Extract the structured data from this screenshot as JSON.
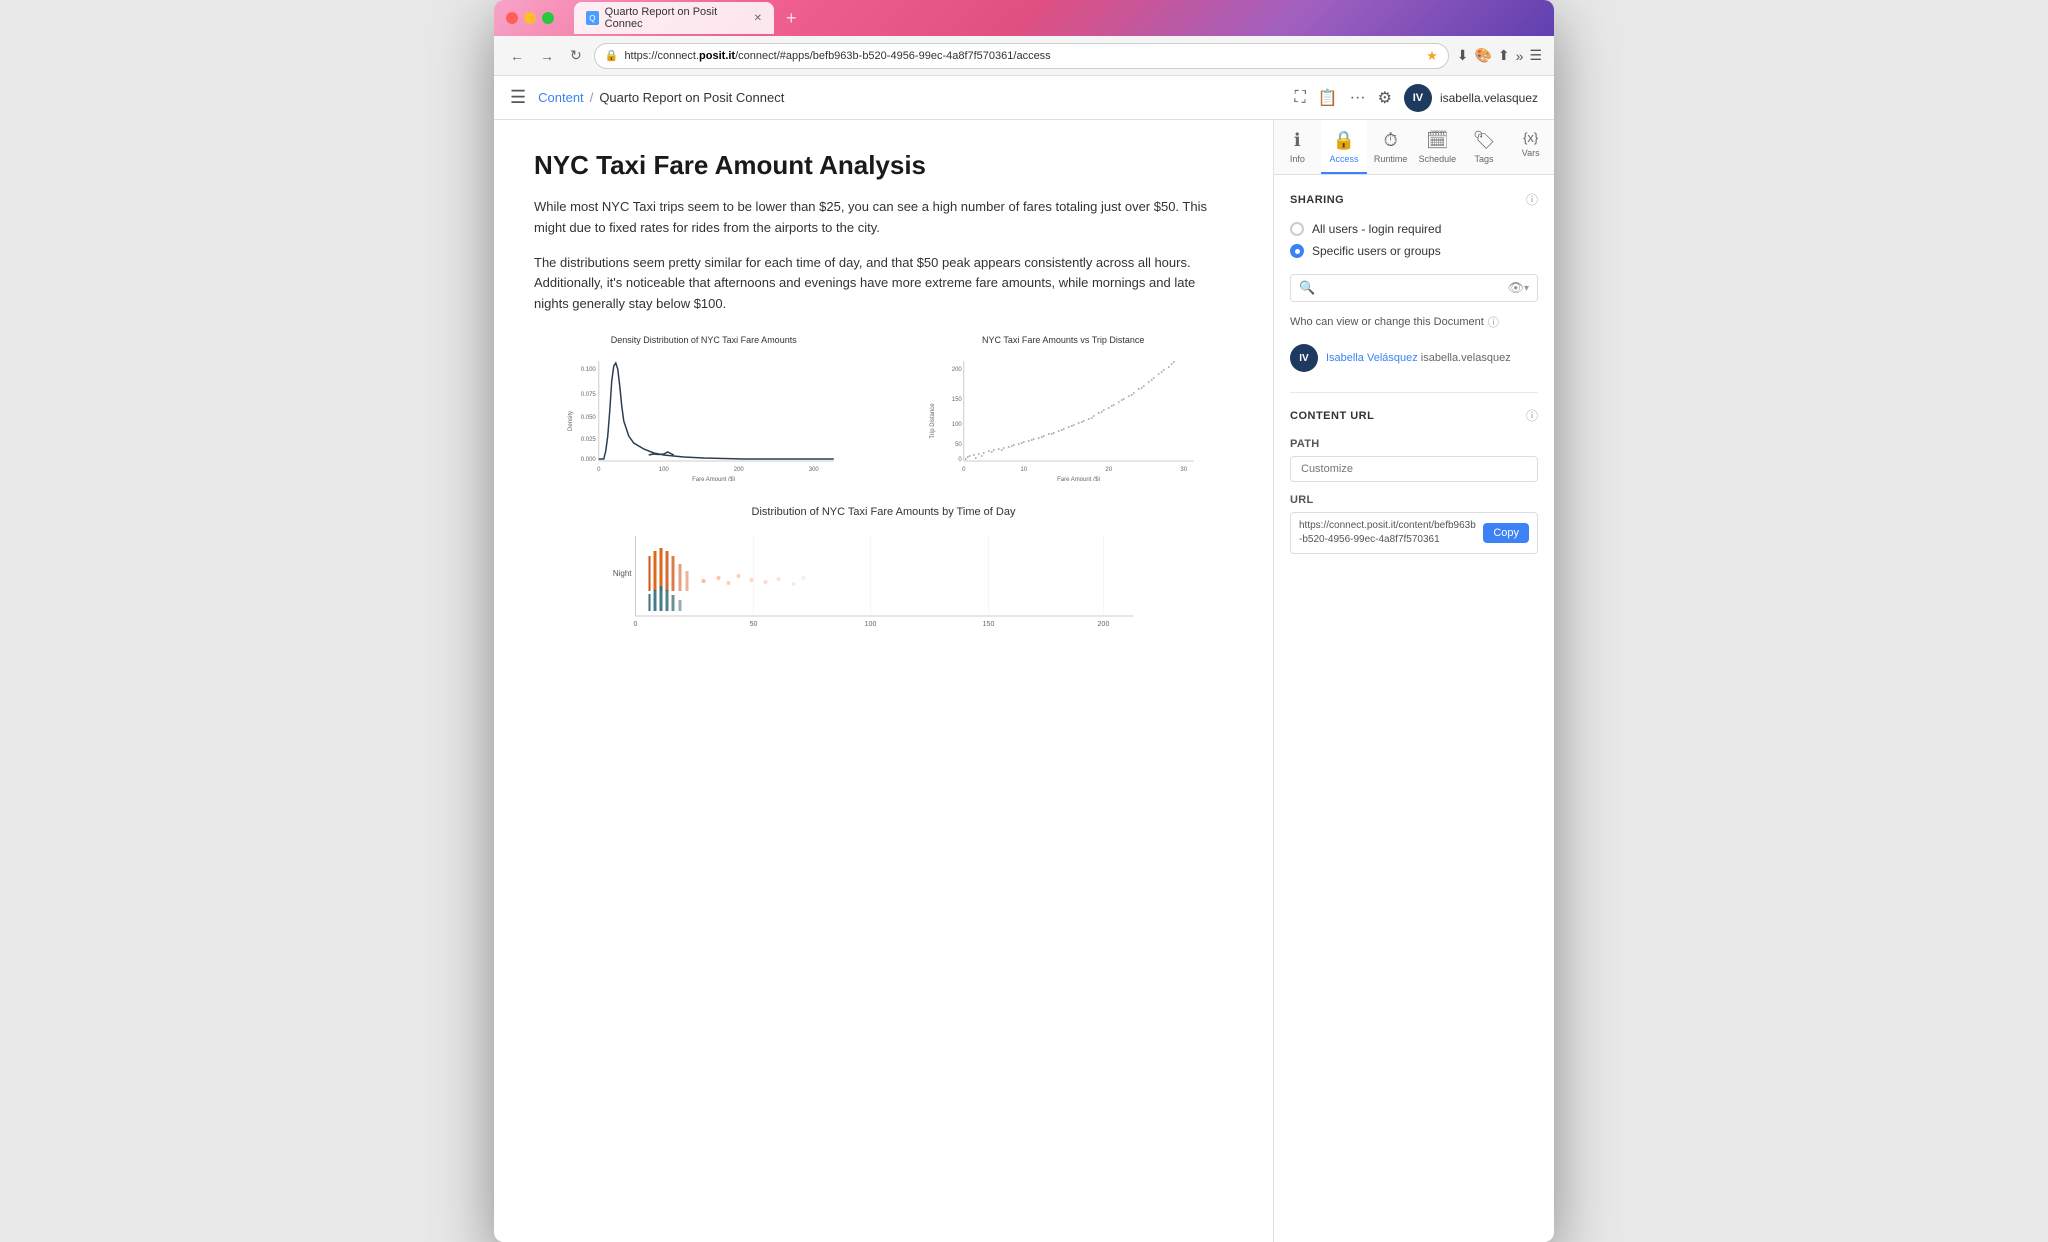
{
  "browser": {
    "tab_label": "Quarto Report on Posit Connec",
    "url": "https://connect.posit.it/connect/#apps/befb963b-b520-4956-99ec-4a8f7f570361/access",
    "url_domain": "connect.posit.it",
    "url_path": "/connect/#apps/befb963b-b520-4956-99ec-4a8f7f570361/access"
  },
  "header": {
    "menu_icon": "☰",
    "breadcrumb_link": "Content",
    "breadcrumb_separator": "/",
    "breadcrumb_current": "Quarto Report on Posit Connect",
    "user_name": "isabella.velasquez",
    "user_initials": "IV"
  },
  "report": {
    "title": "NYC Taxi Fare Amount Analysis",
    "paragraph1": "While most NYC Taxi trips seem to be lower than $25, you can see a high number of fares totaling just over $50. This might due to fixed rates for rides from the airports to the city.",
    "paragraph2": "The distributions seem pretty similar for each time of day, and that $50 peak appears consistently across all hours. Additionally, it's noticeable that afternoons and evenings have more extreme fare amounts, while mornings and late nights generally stay below $100.",
    "chart1_title": "Density Distribution of NYC Taxi Fare Amounts",
    "chart2_title": "NYC Taxi Fare Amounts vs Trip Distance",
    "chart3_title": "Distribution of NYC Taxi Fare Amounts by Time of Day",
    "chart1_x_label": "Fare Amount ($)",
    "chart1_y_label": "Density",
    "chart2_x_label": "Fare Amount ($)",
    "chart2_y_label": "Trip Distance",
    "chart3_y_label": "Night"
  },
  "panel": {
    "nav_items": [
      {
        "id": "info",
        "label": "Info",
        "icon": "ℹ"
      },
      {
        "id": "access",
        "label": "Access",
        "icon": "🔒"
      },
      {
        "id": "runtime",
        "label": "Runtime",
        "icon": "⏱"
      },
      {
        "id": "schedule",
        "label": "Schedule",
        "icon": "🗓"
      },
      {
        "id": "tags",
        "label": "Tags",
        "icon": "🏷"
      },
      {
        "id": "vars",
        "label": "Vars",
        "icon": "{x}"
      }
    ],
    "active_nav": "access",
    "sharing_section": {
      "title": "SHARING",
      "radio_options": [
        {
          "id": "all-users",
          "label": "All users - login required",
          "checked": false
        },
        {
          "id": "specific",
          "label": "Specific users or groups",
          "checked": true
        }
      ],
      "search_placeholder": "",
      "who_view_label": "Who can view or change this Document",
      "user": {
        "initials": "IV",
        "name": "Isabella Velásquez",
        "email": "isabella.velasquez"
      }
    },
    "content_url_section": {
      "title": "CONTENT URL",
      "path_label": "Path",
      "path_placeholder": "Customize",
      "url_label": "URL",
      "url_value": "https://connect.posit.it/content/befb963b-b520-4956-99ec-4a8f7f570361",
      "copy_button_label": "Copy"
    }
  }
}
